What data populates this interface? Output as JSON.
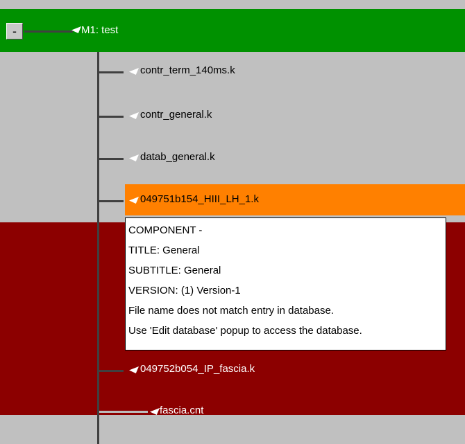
{
  "tree": {
    "root": {
      "label": "M1: test",
      "collapse_button": "-",
      "icon": "model-icon",
      "color": "#009100"
    },
    "children": [
      {
        "label": "contr_term_140ms.k",
        "icon": "file-icon"
      },
      {
        "label": "contr_general.k",
        "icon": "file-icon"
      },
      {
        "label": "datab_general.k",
        "icon": "file-icon"
      },
      {
        "label": "049751b154_HIII_LH_1.k",
        "icon": "file-icon",
        "highlight_color": "#ff8000"
      },
      {
        "label": "049752b054_IP_fascia.k",
        "icon": "file-icon"
      },
      {
        "label": "fascia.cnt",
        "icon": "file-icon"
      }
    ],
    "red_section_color": "#8c0000"
  },
  "tooltip": {
    "lines": [
      "COMPONENT -",
      "TITLE: General",
      "SUBTITLE: General",
      "VERSION: (1) Version-1",
      "File name does not match entry in database.",
      "Use 'Edit database' popup to access the database."
    ]
  }
}
